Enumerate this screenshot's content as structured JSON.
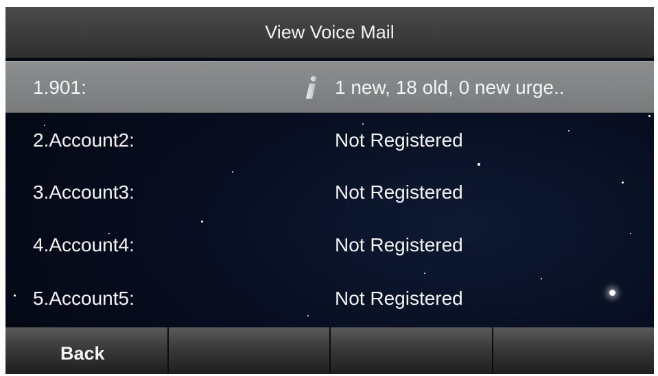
{
  "title": "View Voice Mail",
  "accounts": [
    {
      "label": "1.901:",
      "status": "1 new, 18 old, 0 new urge..",
      "selected": true,
      "icon": "info-icon"
    },
    {
      "label": "2.Account2:",
      "status": "Not Registered"
    },
    {
      "label": "3.Account3:",
      "status": "Not Registered"
    },
    {
      "label": "4.Account4:",
      "status": "Not Registered"
    },
    {
      "label": "5.Account5:",
      "status": "Not Registered"
    }
  ],
  "softkeys": [
    "Back",
    "",
    "",
    ""
  ],
  "colors": {
    "title_bar": "#3f3f3f",
    "selected_row": "#848586",
    "background": "#070d1f",
    "text": "#f4f4f4"
  }
}
